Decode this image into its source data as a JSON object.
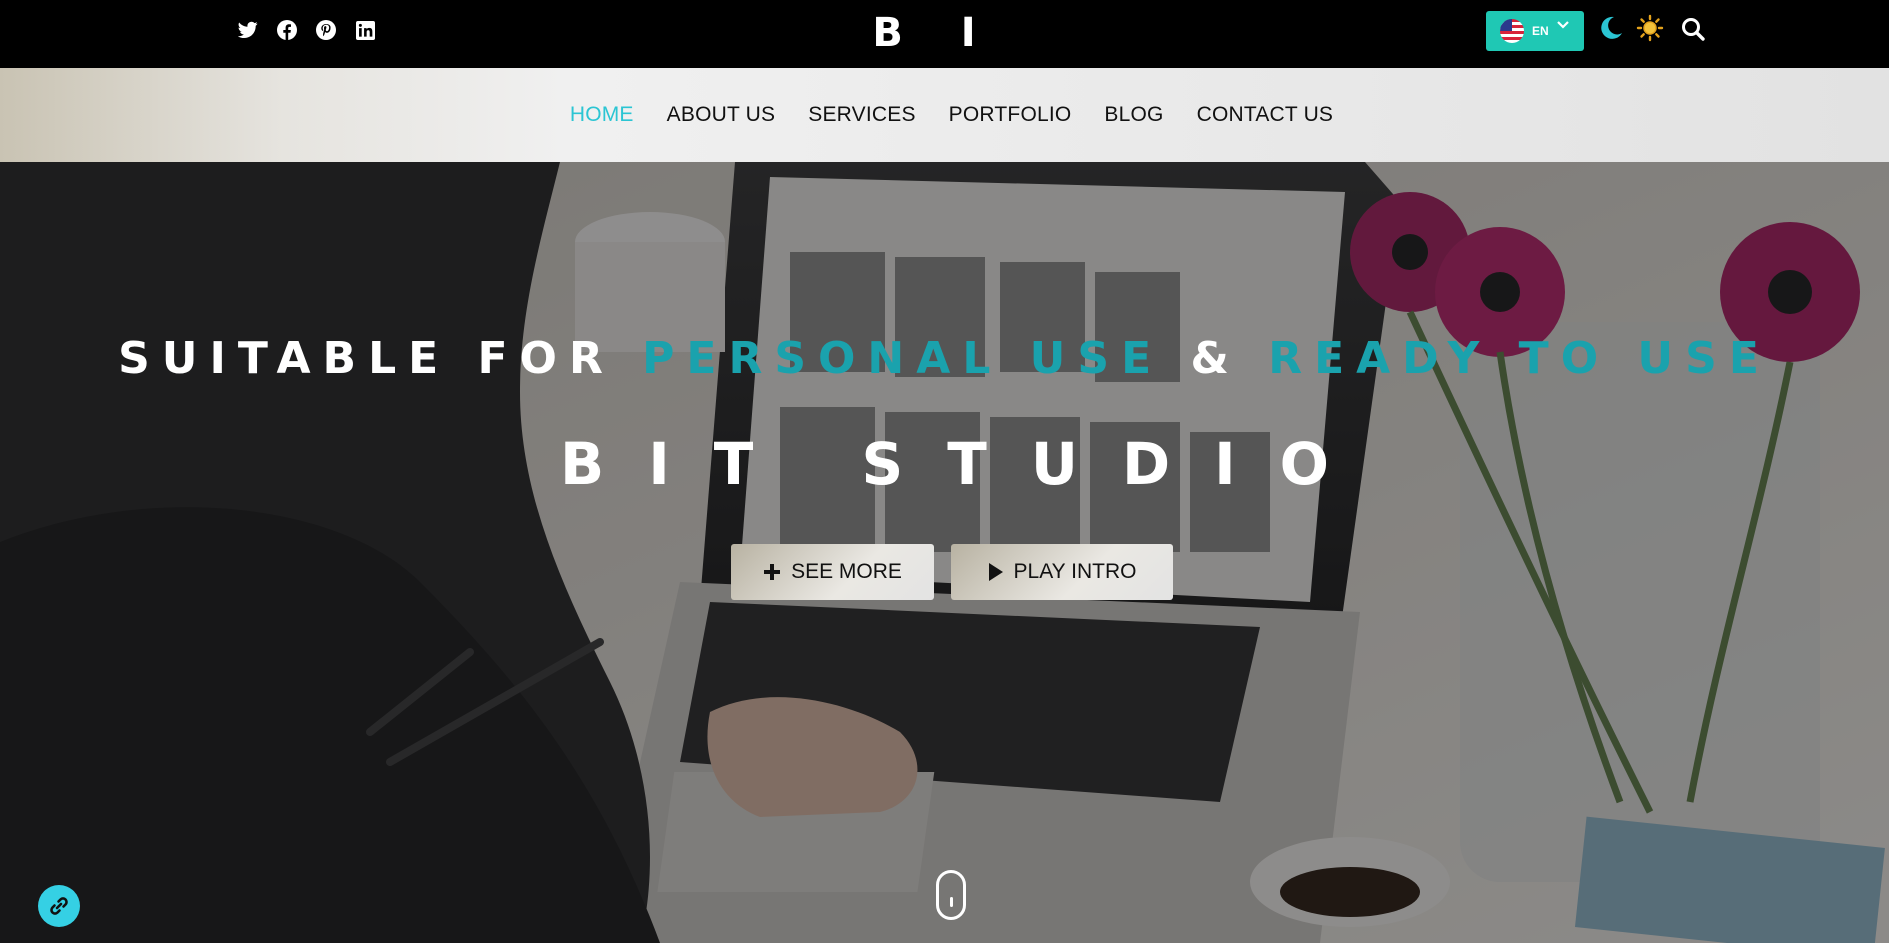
{
  "topbar": {
    "social_icons": [
      "twitter-icon",
      "facebook-icon",
      "pinterest-icon",
      "linkedin-icon"
    ],
    "logo": "B I T",
    "language": {
      "code": "EN",
      "flag": "us-flag-icon"
    },
    "icons": [
      "moon-icon",
      "sun-icon",
      "search-icon"
    ]
  },
  "nav": {
    "items": [
      {
        "label": "HOME",
        "active": true
      },
      {
        "label": "ABOUT US"
      },
      {
        "label": "SERVICES"
      },
      {
        "label": "PORTFOLIO"
      },
      {
        "label": "BLOG"
      },
      {
        "label": "CONTACT US"
      }
    ]
  },
  "hero": {
    "headline": {
      "part1": "SUITABLE FOR",
      "accent1": "PERSONAL USE",
      "amp": "&",
      "accent2": "READY TO USE"
    },
    "title": "BIT STUDIO",
    "buttons": {
      "see_more": "SEE MORE",
      "play_intro": "PLAY INTRO"
    }
  },
  "colors": {
    "accent": "#2bc5d3",
    "headline_accent": "#1aa2ad",
    "language_button": "#1fc8b4",
    "topbar": "#000000"
  }
}
